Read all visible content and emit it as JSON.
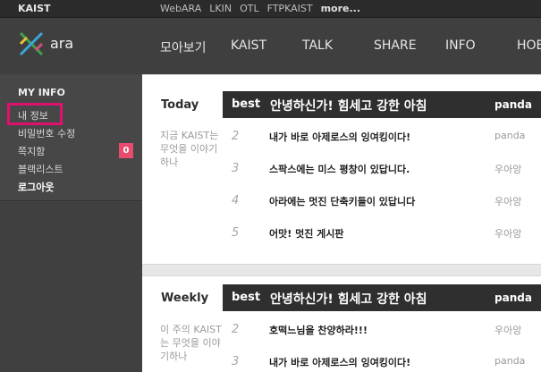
{
  "topbar": {
    "site": "KAIST",
    "links": [
      "WebARA",
      "LKIN",
      "OTL",
      "FTPKAIST",
      "more..."
    ]
  },
  "header": {
    "logo_text": "ara",
    "nav": [
      "모아보기",
      "KAIST",
      "TALK",
      "SHARE",
      "INFO",
      "HOB"
    ]
  },
  "sidebar": {
    "title": "MY INFO",
    "items": [
      {
        "label": "내 정보"
      },
      {
        "label": "비밀번호 수정"
      },
      {
        "label": "쪽지함",
        "badge": "0"
      },
      {
        "label": "블랙리스트"
      },
      {
        "label": "로그아웃"
      }
    ]
  },
  "today": {
    "label": "Today",
    "desc": "지금 KAIST는 무엇을 이야기하나",
    "best": {
      "tag": "best",
      "title": "안녕하신가! 힘세고 강한 아침",
      "author": "panda"
    },
    "rows": [
      {
        "num": "2",
        "title": "내가 바로 아제로스의 잉여킹이다!",
        "author": "panda"
      },
      {
        "num": "3",
        "title": "스팍스에는 미스 평창이 있답니다.",
        "author": "우아앙"
      },
      {
        "num": "4",
        "title": "아라에는 멋진 단축키들이 있답니다",
        "author": "우아앙"
      },
      {
        "num": "5",
        "title": "어맛! 멋진 게시판",
        "author": "우아앙"
      }
    ]
  },
  "weekly": {
    "label": "Weekly",
    "desc": "이 주의 KAIST는 무엇을 이야기하나",
    "best": {
      "tag": "best",
      "title": "안녕하신가! 힘세고 강한 아침",
      "author": "panda"
    },
    "rows": [
      {
        "num": "2",
        "title": "호떡느님을 찬양하라!!!",
        "author": "우아앙"
      },
      {
        "num": "3",
        "title": "내가 바로 아제로스의 잉여킹이다!",
        "author": "panda"
      }
    ]
  }
}
